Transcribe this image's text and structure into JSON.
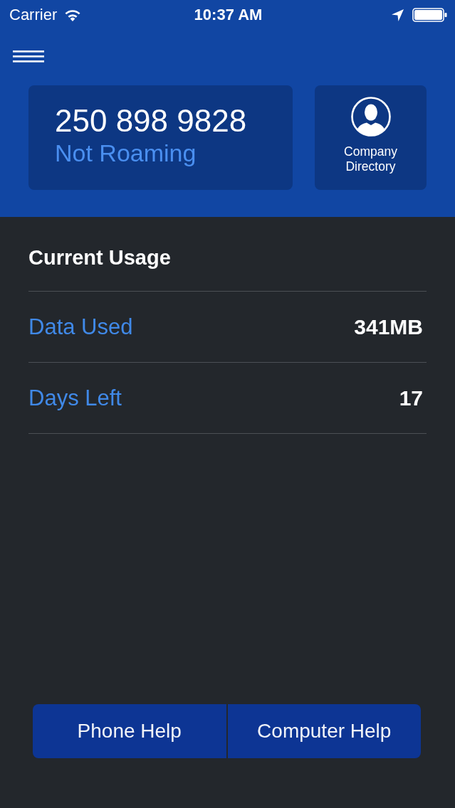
{
  "status_bar": {
    "carrier": "Carrier",
    "time": "10:37 AM"
  },
  "header": {
    "phone_number": "250 898 9828",
    "roaming_status": "Not Roaming",
    "directory_button": {
      "label": "Company Directory"
    }
  },
  "usage": {
    "title": "Current Usage",
    "rows": [
      {
        "label": "Data Used",
        "value": "341MB"
      },
      {
        "label": "Days Left",
        "value": "17"
      }
    ]
  },
  "help_buttons": [
    {
      "label": "Phone Help"
    },
    {
      "label": "Computer Help"
    }
  ]
}
